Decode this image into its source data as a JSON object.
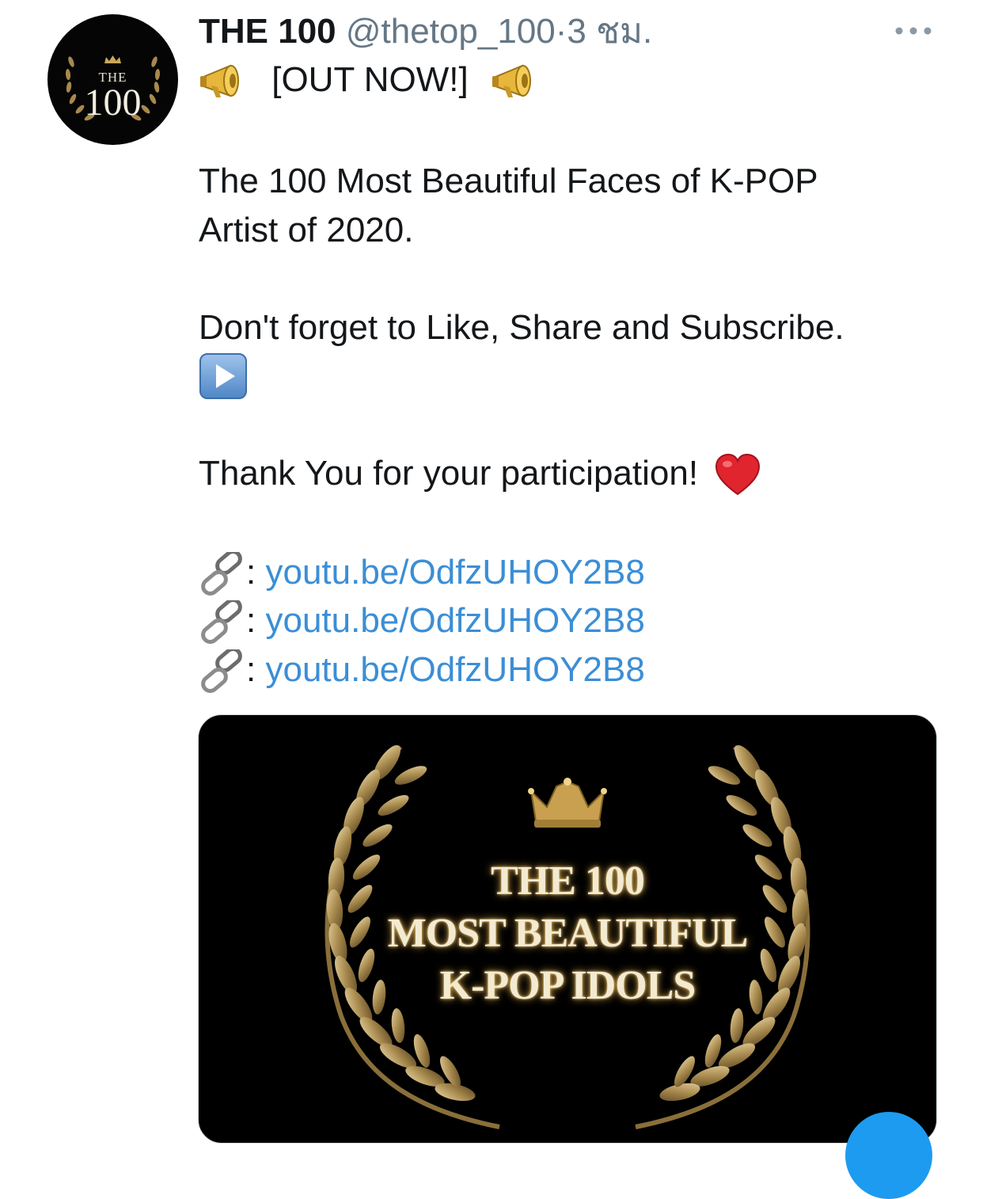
{
  "profile": {
    "avatar_top_text": "THE",
    "avatar_number": "100",
    "display_name": "THE 100",
    "handle": "@thetop_100",
    "separator": "·",
    "time": "3 ชม.",
    "more_icon": "more-horizontal-icon"
  },
  "tweet": {
    "line1_text": "[OUT NOW!]",
    "line1_icon": "megaphone-icon",
    "line2": "The 100 Most Beautiful Faces of K-POP",
    "line3": "Artist of 2020.",
    "line4": "Don't forget to Like, Share and Subscribe.",
    "line5_icon": "play-button-icon",
    "line6": "Thank You for your participation!",
    "line6_icon": "red-heart-icon",
    "link_prefix": ":",
    "links": [
      "youtu.be/OdfzUHOY2B8",
      "youtu.be/OdfzUHOY2B8",
      "youtu.be/OdfzUHOY2B8"
    ],
    "link_icon": "chain-link-icon"
  },
  "media": {
    "title_line1": "THE 100",
    "title_line2": "MOST BEAUTIFUL",
    "title_line3": "K-POP IDOLS",
    "crown_icon": "crown-icon",
    "wreath_icon": "laurel-wreath-icon"
  },
  "colors": {
    "link": "#3b8ed6",
    "muted": "#657786",
    "text": "#14171a",
    "gold": "#b89a5a",
    "fab": "#1d9bf0"
  }
}
